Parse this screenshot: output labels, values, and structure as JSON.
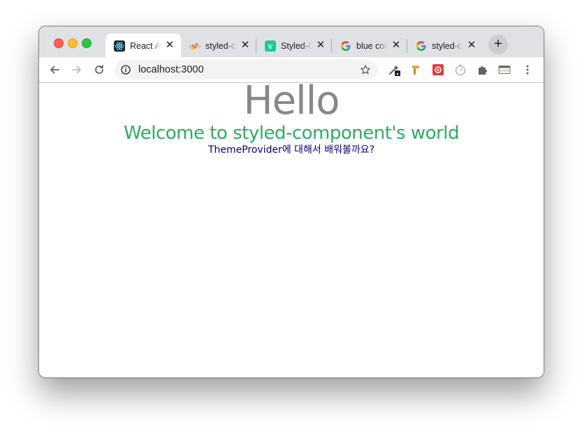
{
  "browser": {
    "tabs": [
      {
        "title": "React App",
        "icon": "react-icon",
        "active": true
      },
      {
        "title": "styled-components",
        "icon": "styled-components-icon",
        "active": false
      },
      {
        "title": "Styled-Components",
        "icon": "velog-icon",
        "active": false
      },
      {
        "title": "blue color",
        "icon": "google-icon",
        "active": false
      },
      {
        "title": "styled-components",
        "icon": "google-icon",
        "active": false
      }
    ],
    "new_tab_label": "+",
    "close_label": "✕",
    "address": "localhost:3000"
  },
  "page": {
    "heading": "Hello",
    "subheading": "Welcome to styled-component's world",
    "caption": "ThemeProvider에 대해서 배워볼까요?"
  },
  "colors": {
    "heading": "#888888",
    "subheading": "#2eaa63",
    "caption": "#000080"
  }
}
